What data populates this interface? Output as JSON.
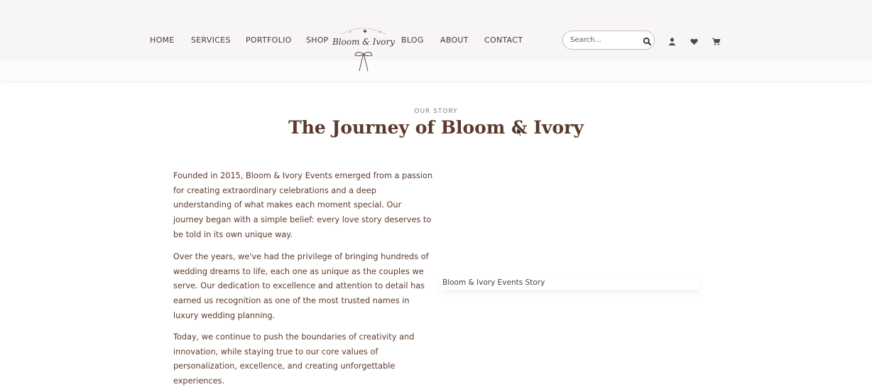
{
  "nav": {
    "left": [
      {
        "label": "HOME"
      },
      {
        "label": "SERVICES"
      },
      {
        "label": "PORTFOLIO"
      },
      {
        "label": "SHOP"
      }
    ],
    "right": [
      {
        "label": "BLOG"
      },
      {
        "label": "ABOUT"
      },
      {
        "label": "CONTACT"
      }
    ]
  },
  "logo": {
    "text": "Bloom & Ivory"
  },
  "search": {
    "placeholder": "Search..."
  },
  "icons": [
    "search-icon",
    "user-icon",
    "heart-icon",
    "cart-icon"
  ],
  "story": {
    "eyebrow": "OUR STORY",
    "title": "The Journey of Bloom & Ivory",
    "paragraphs": [
      "Founded in 2015, Bloom & Ivory Events emerged from a passion for creating extraordinary celebrations and a deep understanding of what makes each moment special. Our journey began with a simple belief: every love story deserves to be told in its own unique way.",
      "Over the years, we've had the privilege of bringing hundreds of wedding dreams to life, each one as unique as the couples we serve. Our dedication to excellence and attention to detail has earned us recognition as one of the most trusted names in luxury wedding planning.",
      "Today, we continue to push the boundaries of creativity and innovation, while staying true to our core values of personalization, excellence, and creating unforgettable experiences."
    ],
    "image_alt": "Bloom & Ivory Events Story"
  },
  "colors": {
    "brand_brown": "#5a3a2c",
    "eyebrow_blue": "#6e7f92",
    "header_bg": "#f7f5f7"
  }
}
